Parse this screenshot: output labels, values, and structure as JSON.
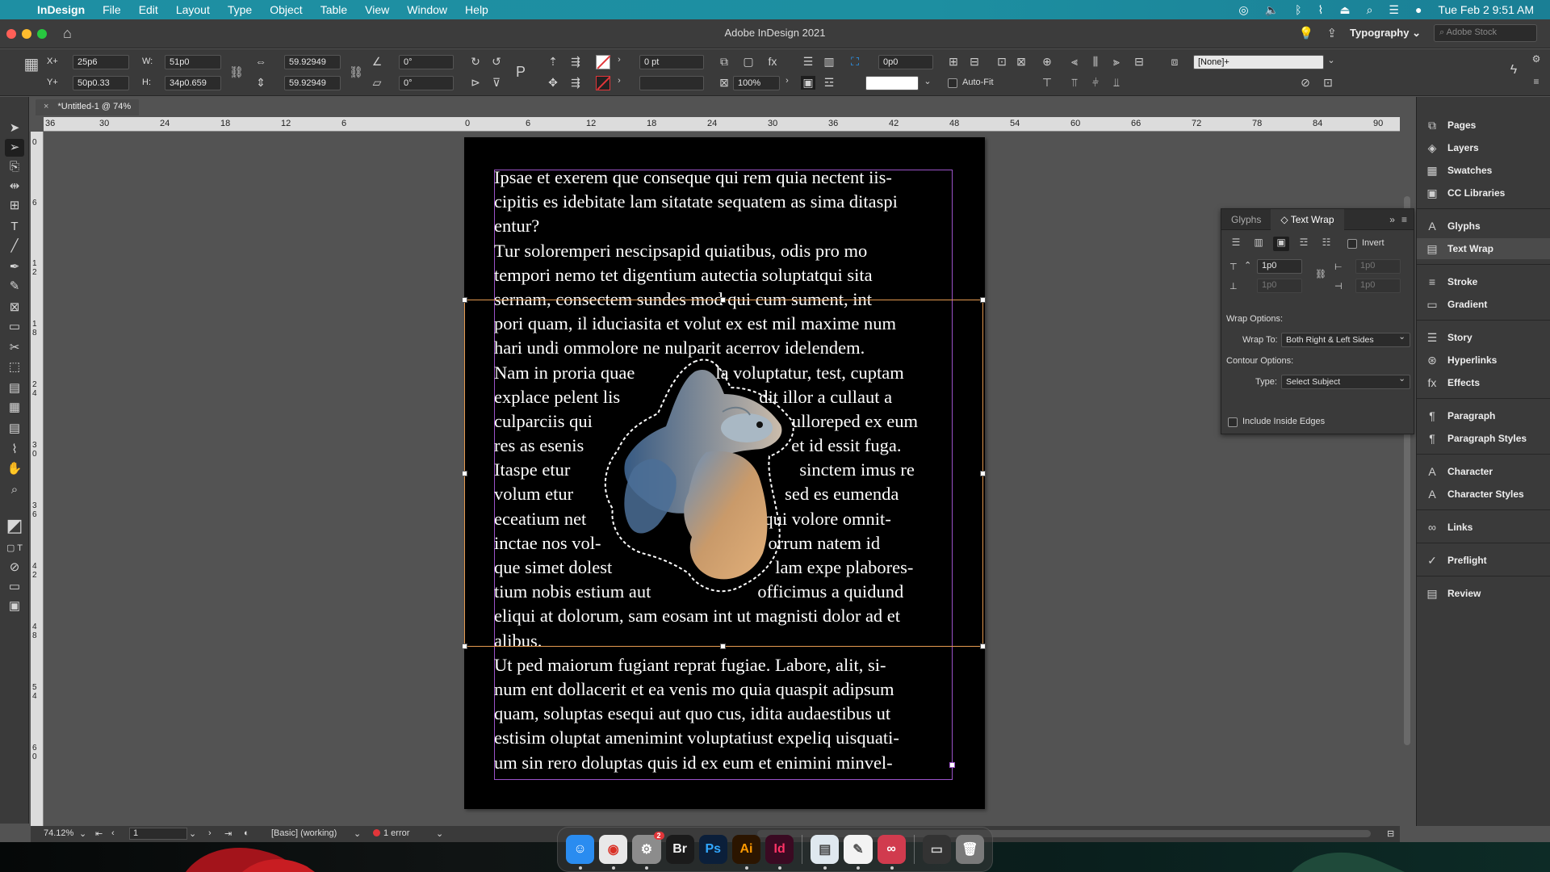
{
  "menubar": {
    "app": "InDesign",
    "menus": [
      "File",
      "Edit",
      "Layout",
      "Type",
      "Object",
      "Table",
      "View",
      "Window",
      "Help"
    ],
    "datetime": "Tue Feb 2  9:51 AM"
  },
  "titlebar": {
    "title": "Adobe InDesign 2021",
    "workspace": "Typography",
    "stock_placeholder": "Adobe Stock"
  },
  "control": {
    "x": "25p6",
    "y": "50p0.33",
    "w": "51p0",
    "h": "34p0.659",
    "scale_x": "59.92949",
    "scale_y": "59.92949",
    "angle": "0°",
    "shear": "0°",
    "stroke_weight": "0 pt",
    "zoom_percent": "100%",
    "offset": "0p0",
    "style": "[None]+",
    "autofit_label": "Auto-Fit"
  },
  "document_tab": "*Untitled-1 @ 74%",
  "ruler": {
    "h_ticks": [
      "36",
      "30",
      "24",
      "18",
      "12",
      "6",
      "0",
      "6",
      "12",
      "18",
      "24",
      "30",
      "36",
      "42",
      "48",
      "54",
      "60",
      "66",
      "72",
      "78",
      "84",
      "90"
    ],
    "v_ticks": [
      "0",
      "6",
      "1 2",
      "1 8",
      "2 4",
      "3 0",
      "3 6",
      "4 2",
      "4 8",
      "5 4",
      "6 0"
    ]
  },
  "body_text": {
    "lines": [
      "Ipsae et exerem que conseque qui rem quia nectent iis-",
      "cipitis es idebitate lam sitatate sequatem as sima ditaspi",
      "entur?",
      "Tur soloremperi nescipsapid quiatibus, odis pro mo",
      "tempori nemo tet digentium autectia soluptatqui sita",
      "sernam, consectem sundes mod qui cum sument, int",
      "pori quam, il iduciasita et volut ex est mil maxime num",
      "hari undi ommolore ne nulparit acerrov idelendem."
    ],
    "wrap_lines": [
      [
        "Nam in proria quae",
        "la voluptatur, test, cuptam"
      ],
      [
        "explace pelent lis",
        "dit illor a cullaut a"
      ],
      [
        "culparciis qui",
        "ulloreped ex eum"
      ],
      [
        "res as esenis",
        "et id essit fuga."
      ],
      [
        "Itaspe etur",
        "sinctem imus re"
      ],
      [
        "volum etur",
        "sed es eumenda"
      ],
      [
        "eceatium net",
        "qui volore omnit-"
      ],
      [
        "inctae nos vol-",
        "orrum natem id"
      ],
      [
        "que simet dolest",
        "lam expe plabores-"
      ],
      [
        "tium nobis estium aut",
        "officimus a quidund"
      ]
    ],
    "tail_lines": [
      "eliqui at dolorum, sam eosam int ut magnisti dolor ad et",
      "alibus.",
      "Ut ped maiorum fugiant reprat fugiae. Labore, alit, si-",
      "num ent dollacerit et ea venis mo quia quaspit adipsum",
      "quam, soluptas esequi aut quo cus, idita audaestibus ut",
      "estisim oluptat amenimint voluptatiust expeliq uisquati-",
      "um sin rero doluptas quis id ex eum et enimini minvel-"
    ]
  },
  "status": {
    "zoom": "74.12%",
    "page": "1",
    "preflight_profile": "[Basic] (working)",
    "errors": "1 error"
  },
  "text_wrap_panel": {
    "tab_glyphs": "Glyphs",
    "tab_text_wrap": "Text Wrap",
    "invert_label": "Invert",
    "top_offset": "1p0",
    "bottom_offset": "1p0",
    "left_offset": "1p0",
    "right_offset": "1p0",
    "wrap_options_label": "Wrap Options:",
    "wrap_to_label": "Wrap To:",
    "wrap_to_value": "Both Right & Left Sides",
    "contour_options_label": "Contour Options:",
    "type_label": "Type:",
    "type_value": "Select Subject",
    "include_inside_edges": "Include Inside Edges"
  },
  "dock_panels": [
    {
      "label": "Pages",
      "icon": "pages-icon"
    },
    {
      "label": "Layers",
      "icon": "layers-icon"
    },
    {
      "label": "Swatches",
      "icon": "swatches-icon"
    },
    {
      "label": "CC Libraries",
      "icon": "cc-libraries-icon"
    },
    {
      "label": "Glyphs",
      "icon": "glyphs-icon"
    },
    {
      "label": "Text Wrap",
      "icon": "text-wrap-icon"
    },
    {
      "label": "Stroke",
      "icon": "stroke-icon"
    },
    {
      "label": "Gradient",
      "icon": "gradient-icon"
    },
    {
      "label": "Story",
      "icon": "story-icon"
    },
    {
      "label": "Hyperlinks",
      "icon": "hyperlinks-icon"
    },
    {
      "label": "Effects",
      "icon": "effects-icon"
    },
    {
      "label": "Paragraph",
      "icon": "paragraph-icon"
    },
    {
      "label": "Paragraph Styles",
      "icon": "paragraph-styles-icon"
    },
    {
      "label": "Character",
      "icon": "character-icon"
    },
    {
      "label": "Character Styles",
      "icon": "character-styles-icon"
    },
    {
      "label": "Links",
      "icon": "links-icon"
    },
    {
      "label": "Preflight",
      "icon": "preflight-icon"
    },
    {
      "label": "Review",
      "icon": "review-icon"
    }
  ],
  "macdock": {
    "apps": [
      {
        "label": "",
        "name": "finder",
        "color": "#2a8cf0"
      },
      {
        "label": "",
        "name": "chrome",
        "color": "#e8e8e8"
      },
      {
        "label": "",
        "name": "system-preferences",
        "color": "#8c8c8c"
      },
      {
        "label": "Br",
        "name": "bridge",
        "color": "#1b1b1b"
      },
      {
        "label": "Ps",
        "name": "photoshop",
        "color": "#0b1f3a"
      },
      {
        "label": "Ai",
        "name": "illustrator",
        "color": "#2b1500"
      },
      {
        "label": "Id",
        "name": "indesign",
        "color": "#3a0a22"
      },
      {
        "label": "",
        "name": "preview",
        "color": "#dfe8ef"
      },
      {
        "label": "",
        "name": "textedit",
        "color": "#f3f3f3"
      },
      {
        "label": "",
        "name": "creative-cloud",
        "color": "#d13b4e"
      },
      {
        "label": "",
        "name": "terminal",
        "color": "#333"
      },
      {
        "label": "",
        "name": "trash",
        "color": "#7a7a7a"
      }
    ],
    "badge": "2"
  },
  "colors": {
    "menubar": "#1d8fa1",
    "frame_purple": "#9b53c9",
    "frame_orange": "#e59a50",
    "error_red": "#e2363a"
  }
}
